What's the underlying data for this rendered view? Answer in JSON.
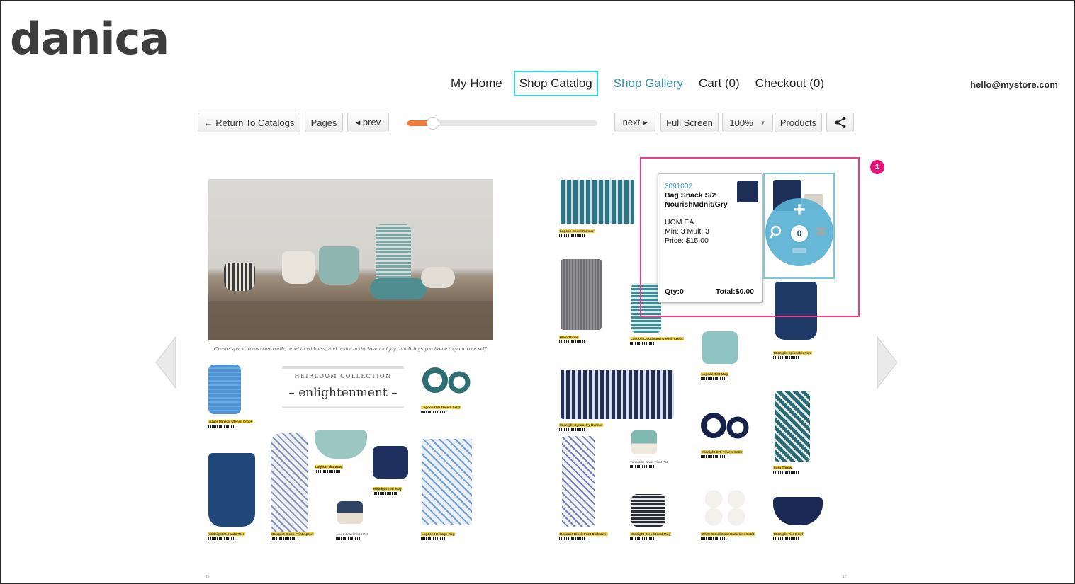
{
  "brand": {
    "logo_text": "danica"
  },
  "nav": {
    "items": [
      {
        "label": "My Home"
      },
      {
        "label": "Shop Catalog"
      },
      {
        "label": "Shop Gallery"
      },
      {
        "label": "Cart (0)"
      },
      {
        "label": "Checkout (0)"
      }
    ],
    "active_index": 1,
    "email": "hello@mystore.com"
  },
  "toolbar": {
    "return_label": "← Return To Catalogs",
    "pages_label": "Pages",
    "prev_label": "◂ prev",
    "next_label": "next ▸",
    "fullscreen_label": "Full Screen",
    "zoom_label": "100%",
    "zoom_caret": "▼",
    "products_label": "Products",
    "slider_progress": 0.1
  },
  "colors": {
    "accent_orange": "#f07b3a",
    "highlight_pink": "#e83e8c",
    "active_nav_border": "#2ad5df",
    "link_blue": "#3a8fb0",
    "wheel_blue": "#5ab2d4"
  },
  "left_page": {
    "tagline": "Create space to uncover truth, revel in stillness, and invite in the love and joy that brings you home to your true self.",
    "collection_label": "HEIRLOOM COLLECTION",
    "collection_title": "– enlightenment –",
    "page_number": "16"
  },
  "right_page": {
    "page_number": "17"
  },
  "annotation": {
    "badge": "1"
  },
  "product_popup": {
    "sku": "3091002",
    "name_line1": "Bag Snack S/2",
    "name_line2": "NourishMdnit/Gry",
    "uom": "UOM EA",
    "min_mult": "Min: 3 Mult: 3",
    "price": "Price: $15.00",
    "qty": "Qty:0",
    "total": "Total:$0.00"
  },
  "qty_wheel": {
    "value": "0",
    "plus": "+",
    "close": "✖"
  },
  "product_labels": [
    {
      "title": "Azure Mineral Utensil Crock"
    },
    {
      "title": "Lagoon Orb Trivets Set/2"
    },
    {
      "title": "Lagoon Tint Bowl"
    },
    {
      "title": "Midnight Tint Mug"
    },
    {
      "title": "Midnight Mercado Tote"
    },
    {
      "title": "Bouquet Block Print Apron"
    },
    {
      "title": "Azure Jewel Plant Pot"
    },
    {
      "title": "Lagoon Heritage Rug"
    },
    {
      "title": "Lagoon Spool Runner"
    },
    {
      "title": "Plain Throw"
    },
    {
      "title": "Lagoon CloudBurst Utensil Crock"
    },
    {
      "title": "Lagoon Tint Mug"
    },
    {
      "title": "Midnight Spinnaker Tote"
    },
    {
      "title": "Midnight Symmetry Runner"
    },
    {
      "title": "Turquoise Jewel Plant Pot"
    },
    {
      "title": "Midnight Orb Trivets Set/2"
    },
    {
      "title": "Ecru Throw"
    },
    {
      "title": "Bouquet Block Print Dishtowel"
    },
    {
      "title": "Midnight CloudBurst Mug"
    },
    {
      "title": "White CloudBurst Ramekins Set/4"
    },
    {
      "title": "Midnight Tint Bowl"
    }
  ]
}
